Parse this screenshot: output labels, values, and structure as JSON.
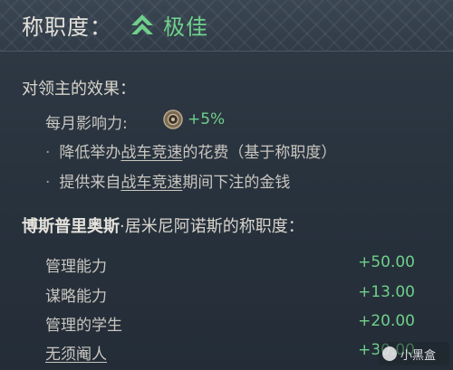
{
  "header": {
    "label": "称职度：",
    "value": "极佳",
    "value_color": "#6fd08b",
    "icon": "up-double-chevron-icon"
  },
  "effects": {
    "title": "对领主的效果：",
    "monthly": {
      "label": "每月影响力:",
      "icon": "influence-coin-icon",
      "value": "+5%"
    },
    "bullets": [
      {
        "prefix": "降低举办",
        "link": "战车竞速",
        "suffix": "的花费（基于称职度）"
      },
      {
        "prefix": "提供来自",
        "link": "战车竞速",
        "suffix": "期间下注的金钱"
      }
    ]
  },
  "competence": {
    "name": "博斯普里奥斯",
    "rest": "·居米尼阿诺斯的称职度：",
    "rows": [
      {
        "label": "管理能力",
        "value": "+50.00",
        "underline": false
      },
      {
        "label": "谋略能力",
        "value": "+13.00",
        "underline": false
      },
      {
        "label": "管理的学生",
        "value": "+20.00",
        "underline": false
      },
      {
        "label": "无须阉人",
        "value": "+30.00",
        "underline": true
      }
    ]
  },
  "watermark": {
    "text": "小黑盒"
  }
}
